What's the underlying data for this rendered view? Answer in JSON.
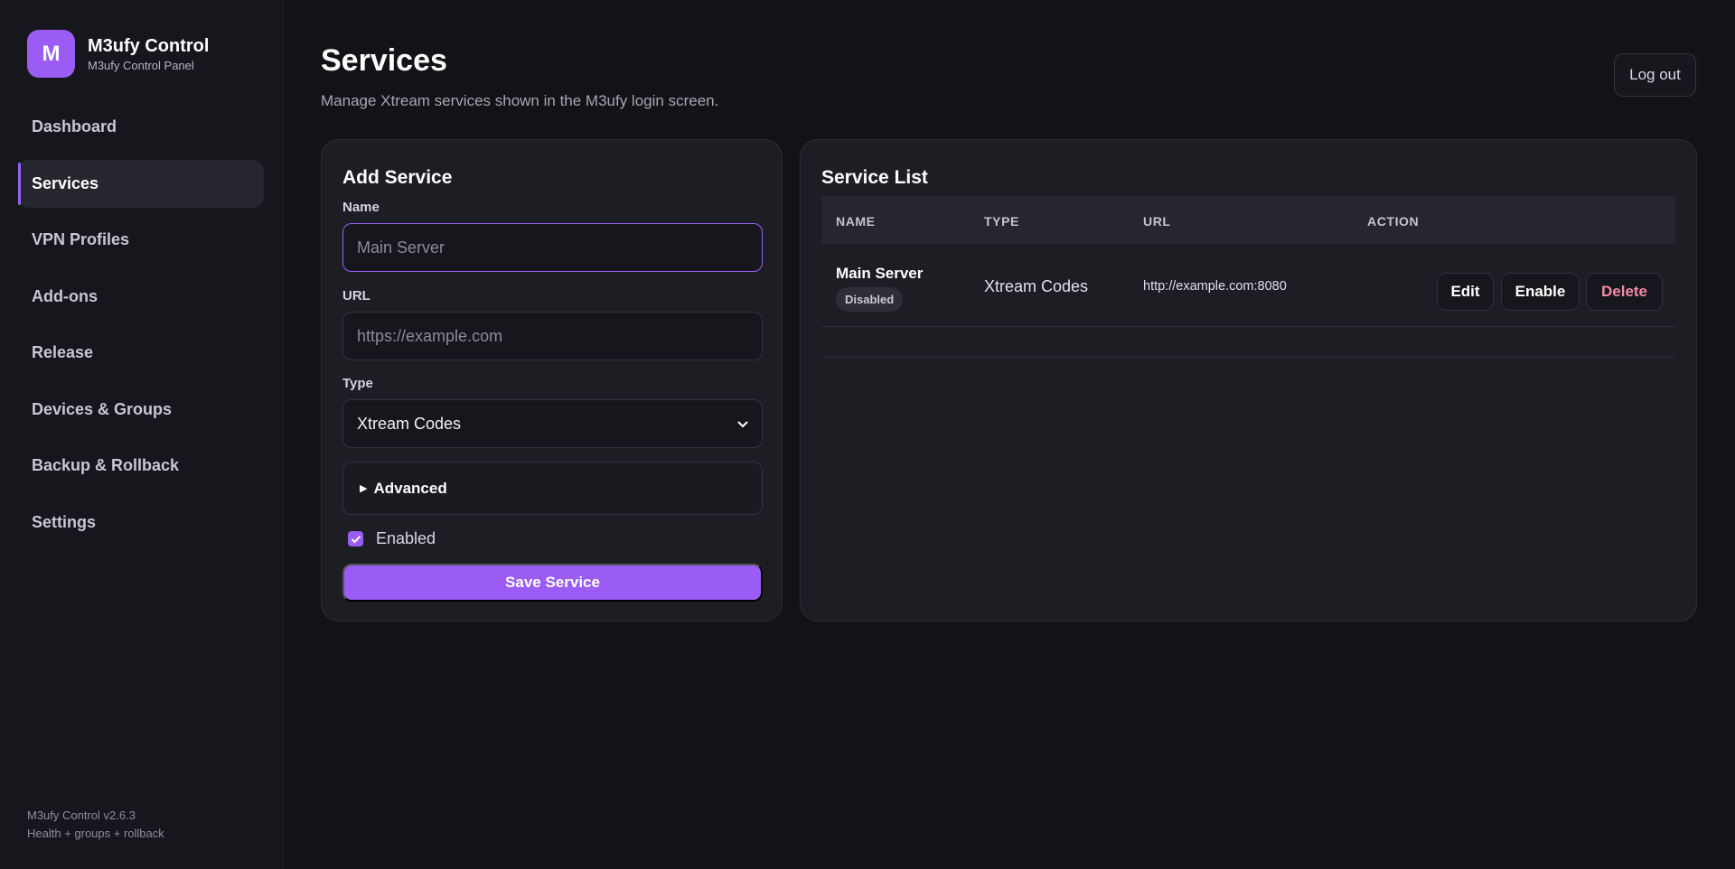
{
  "brand": {
    "logo_letter": "M",
    "name": "M3ufy Control",
    "subtitle": "M3ufy Control Panel"
  },
  "sidebar": {
    "items": [
      {
        "label": "Dashboard",
        "active": false
      },
      {
        "label": "Services",
        "active": true
      },
      {
        "label": "VPN Profiles",
        "active": false
      },
      {
        "label": "Add-ons",
        "active": false
      },
      {
        "label": "Release",
        "active": false
      },
      {
        "label": "Devices & Groups",
        "active": false
      },
      {
        "label": "Backup & Rollback",
        "active": false
      },
      {
        "label": "Settings",
        "active": false
      }
    ],
    "footer": {
      "version": "M3ufy Control v2.6.3",
      "tagline": "Health + groups + rollback"
    }
  },
  "header": {
    "title": "Services",
    "subtitle": "Manage Xtream services shown in the M3ufy login screen.",
    "logout_label": "Log out"
  },
  "add_service": {
    "title": "Add Service",
    "name_label": "Name",
    "name_placeholder": "Main Server",
    "url_label": "URL",
    "url_placeholder": "https://example.com",
    "type_label": "Type",
    "type_value": "Xtream Codes",
    "advanced_label": "Advanced",
    "enabled_label": "Enabled",
    "enabled_checked": true,
    "save_label": "Save Service"
  },
  "service_list": {
    "title": "Service List",
    "columns": [
      "NAME",
      "TYPE",
      "URL",
      "ACTION"
    ],
    "rows": [
      {
        "name": "Main Server",
        "status": "Disabled",
        "type": "Xtream Codes",
        "url": "http://example.com:8080",
        "actions": {
          "edit": "Edit",
          "enable": "Enable",
          "delete": "Delete"
        }
      }
    ]
  },
  "colors": {
    "accent": "#9b5cf6",
    "background": "#121317",
    "card": "#1d1e24",
    "danger_text": "#f38aa4"
  }
}
